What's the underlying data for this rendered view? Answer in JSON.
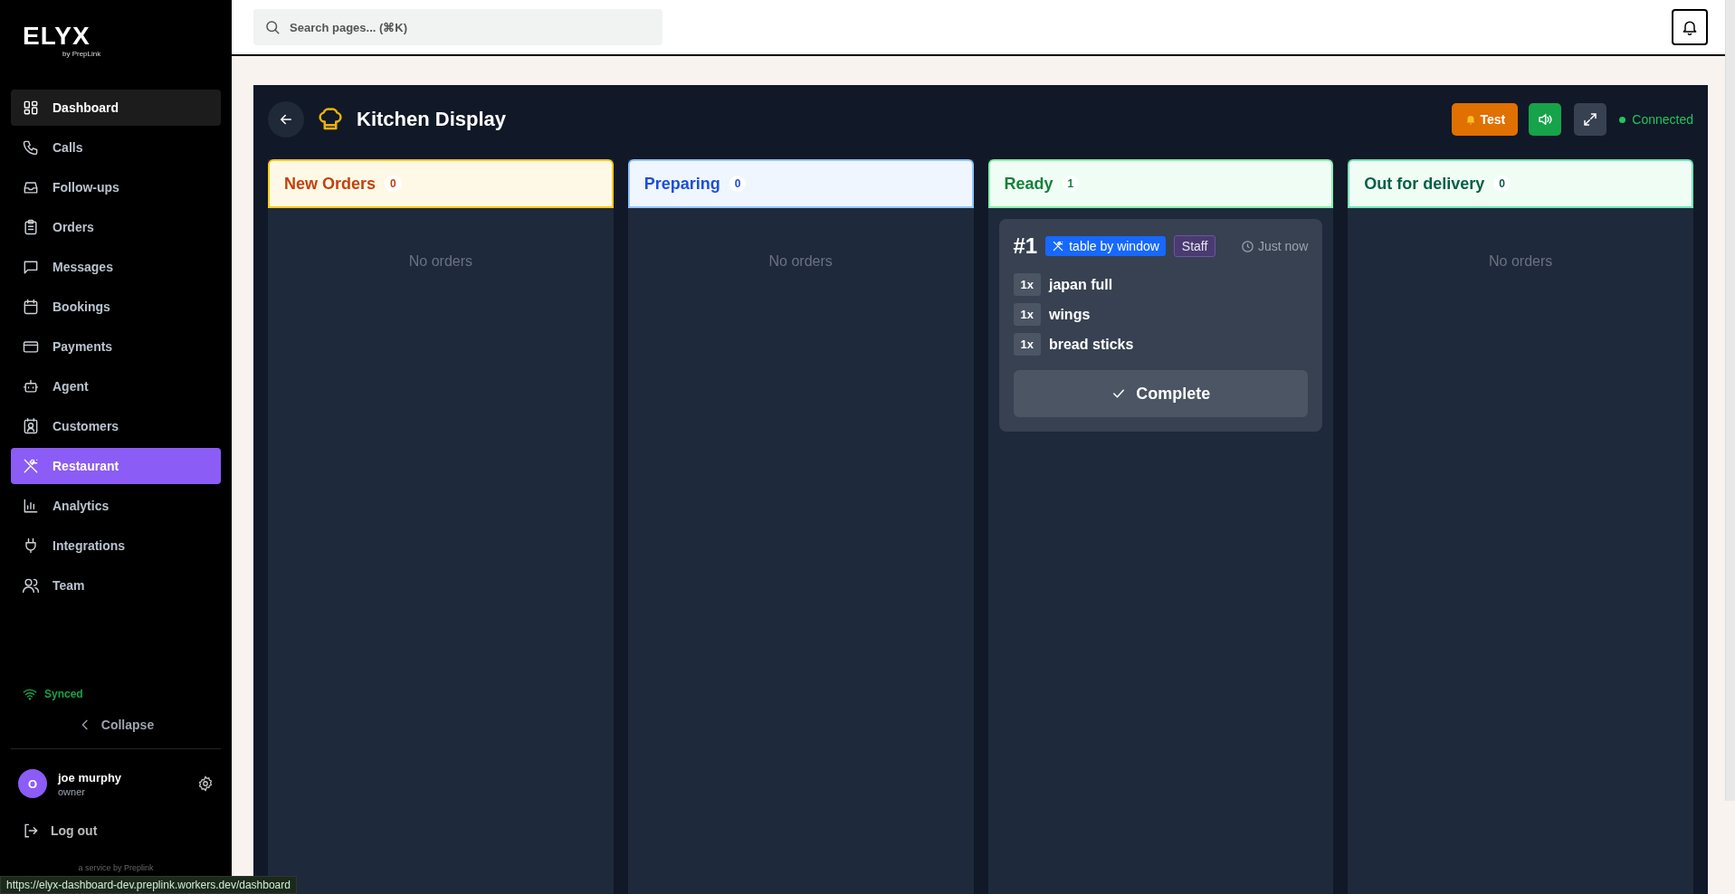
{
  "sidebar": {
    "logo": "ELYX",
    "logo_sub": "by PrepLink",
    "items": [
      {
        "label": "Dashboard",
        "kind": "grid",
        "selected": false,
        "hovered": true
      },
      {
        "label": "Calls",
        "kind": "phone",
        "selected": false,
        "hovered": false
      },
      {
        "label": "Follow-ups",
        "kind": "inbox",
        "selected": false,
        "hovered": false
      },
      {
        "label": "Orders",
        "kind": "clipboard",
        "selected": false,
        "hovered": false
      },
      {
        "label": "Messages",
        "kind": "chat",
        "selected": false,
        "hovered": false
      },
      {
        "label": "Bookings",
        "kind": "calendar",
        "selected": false,
        "hovered": false
      },
      {
        "label": "Payments",
        "kind": "card",
        "selected": false,
        "hovered": false
      },
      {
        "label": "Agent",
        "kind": "bot",
        "selected": false,
        "hovered": false
      },
      {
        "label": "Customers",
        "kind": "contact",
        "selected": false,
        "hovered": false
      },
      {
        "label": "Restaurant",
        "kind": "utensils",
        "selected": true,
        "hovered": false
      },
      {
        "label": "Analytics",
        "kind": "chart",
        "selected": false,
        "hovered": false
      },
      {
        "label": "Integrations",
        "kind": "plug",
        "selected": false,
        "hovered": false
      },
      {
        "label": "Team",
        "kind": "users",
        "selected": false,
        "hovered": false
      }
    ],
    "sync_status": "Synced",
    "collapse": "Collapse",
    "user": {
      "initial": "O",
      "name": "joe murphy",
      "role": "owner"
    },
    "logout": "Log out",
    "footer": "a service by Preplink"
  },
  "search": {
    "placeholder": "Search pages... (⌘K)"
  },
  "kitchen": {
    "title": "Kitchen Display",
    "test_button": "Test",
    "sound_on": true,
    "connection": "Connected",
    "columns": [
      {
        "title": "New Orders",
        "count": "0",
        "kind": "new",
        "empty_text": "No orders"
      },
      {
        "title": "Preparing",
        "count": "0",
        "kind": "preparing",
        "empty_text": "No orders"
      },
      {
        "title": "Ready",
        "count": "1",
        "kind": "ready",
        "orders": [
          {
            "number": "#1",
            "table": "table by window",
            "source": "Staff",
            "time": "Just now",
            "items": [
              {
                "qty": "1x",
                "name": "japan full"
              },
              {
                "qty": "1x",
                "name": "wings"
              },
              {
                "qty": "1x",
                "name": "bread sticks"
              }
            ],
            "action": "Complete"
          }
        ]
      },
      {
        "title": "Out for delivery",
        "count": "0",
        "kind": "delivery",
        "empty_text": "No orders"
      }
    ]
  },
  "status_url": "https://elyx-dashboard-dev.preplink.workers.dev/dashboard"
}
